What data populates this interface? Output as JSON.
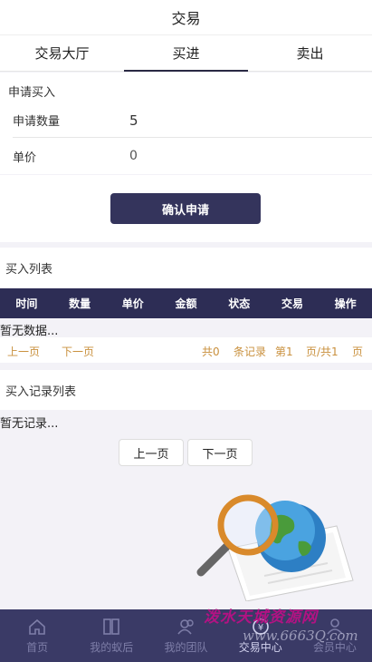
{
  "header": {
    "title": "交易"
  },
  "tabs": [
    {
      "label": "交易大厅"
    },
    {
      "label": "买进"
    },
    {
      "label": "卖出"
    }
  ],
  "form": {
    "title": "申请买入",
    "quantity_label": "申请数量",
    "quantity_value": "5",
    "price_label": "单价",
    "price_value": "0",
    "confirm_label": "确认申请"
  },
  "buy_list": {
    "title": "买入列表",
    "columns": [
      "时间",
      "数量",
      "单价",
      "金额",
      "状态",
      "交易",
      "操作"
    ],
    "empty_text": "暂无数据...",
    "pager": {
      "prev": "上一页",
      "next": "下一页",
      "total_prefix": "共0",
      "total_unit": "条记录",
      "page_prefix": "第1",
      "page_of": "页/共1",
      "page_suffix": "页"
    }
  },
  "record_list": {
    "title": "买入记录列表",
    "empty_text": "暂无记录...",
    "prev": "上一页",
    "next": "下一页"
  },
  "bottom_nav": [
    {
      "label": "首页",
      "icon": "home-icon"
    },
    {
      "label": "我的蚁后",
      "icon": "book-icon"
    },
    {
      "label": "我的团队",
      "icon": "team-icon"
    },
    {
      "label": "交易中心",
      "icon": "trade-icon"
    },
    {
      "label": "会员中心",
      "icon": "member-icon"
    }
  ],
  "watermark": {
    "text": "泼水天城资源网",
    "url": "www.6663Q.com"
  },
  "colors": {
    "primary": "#2d2d55",
    "accent": "#c9903d",
    "nav_bg": "#3a3a66"
  }
}
